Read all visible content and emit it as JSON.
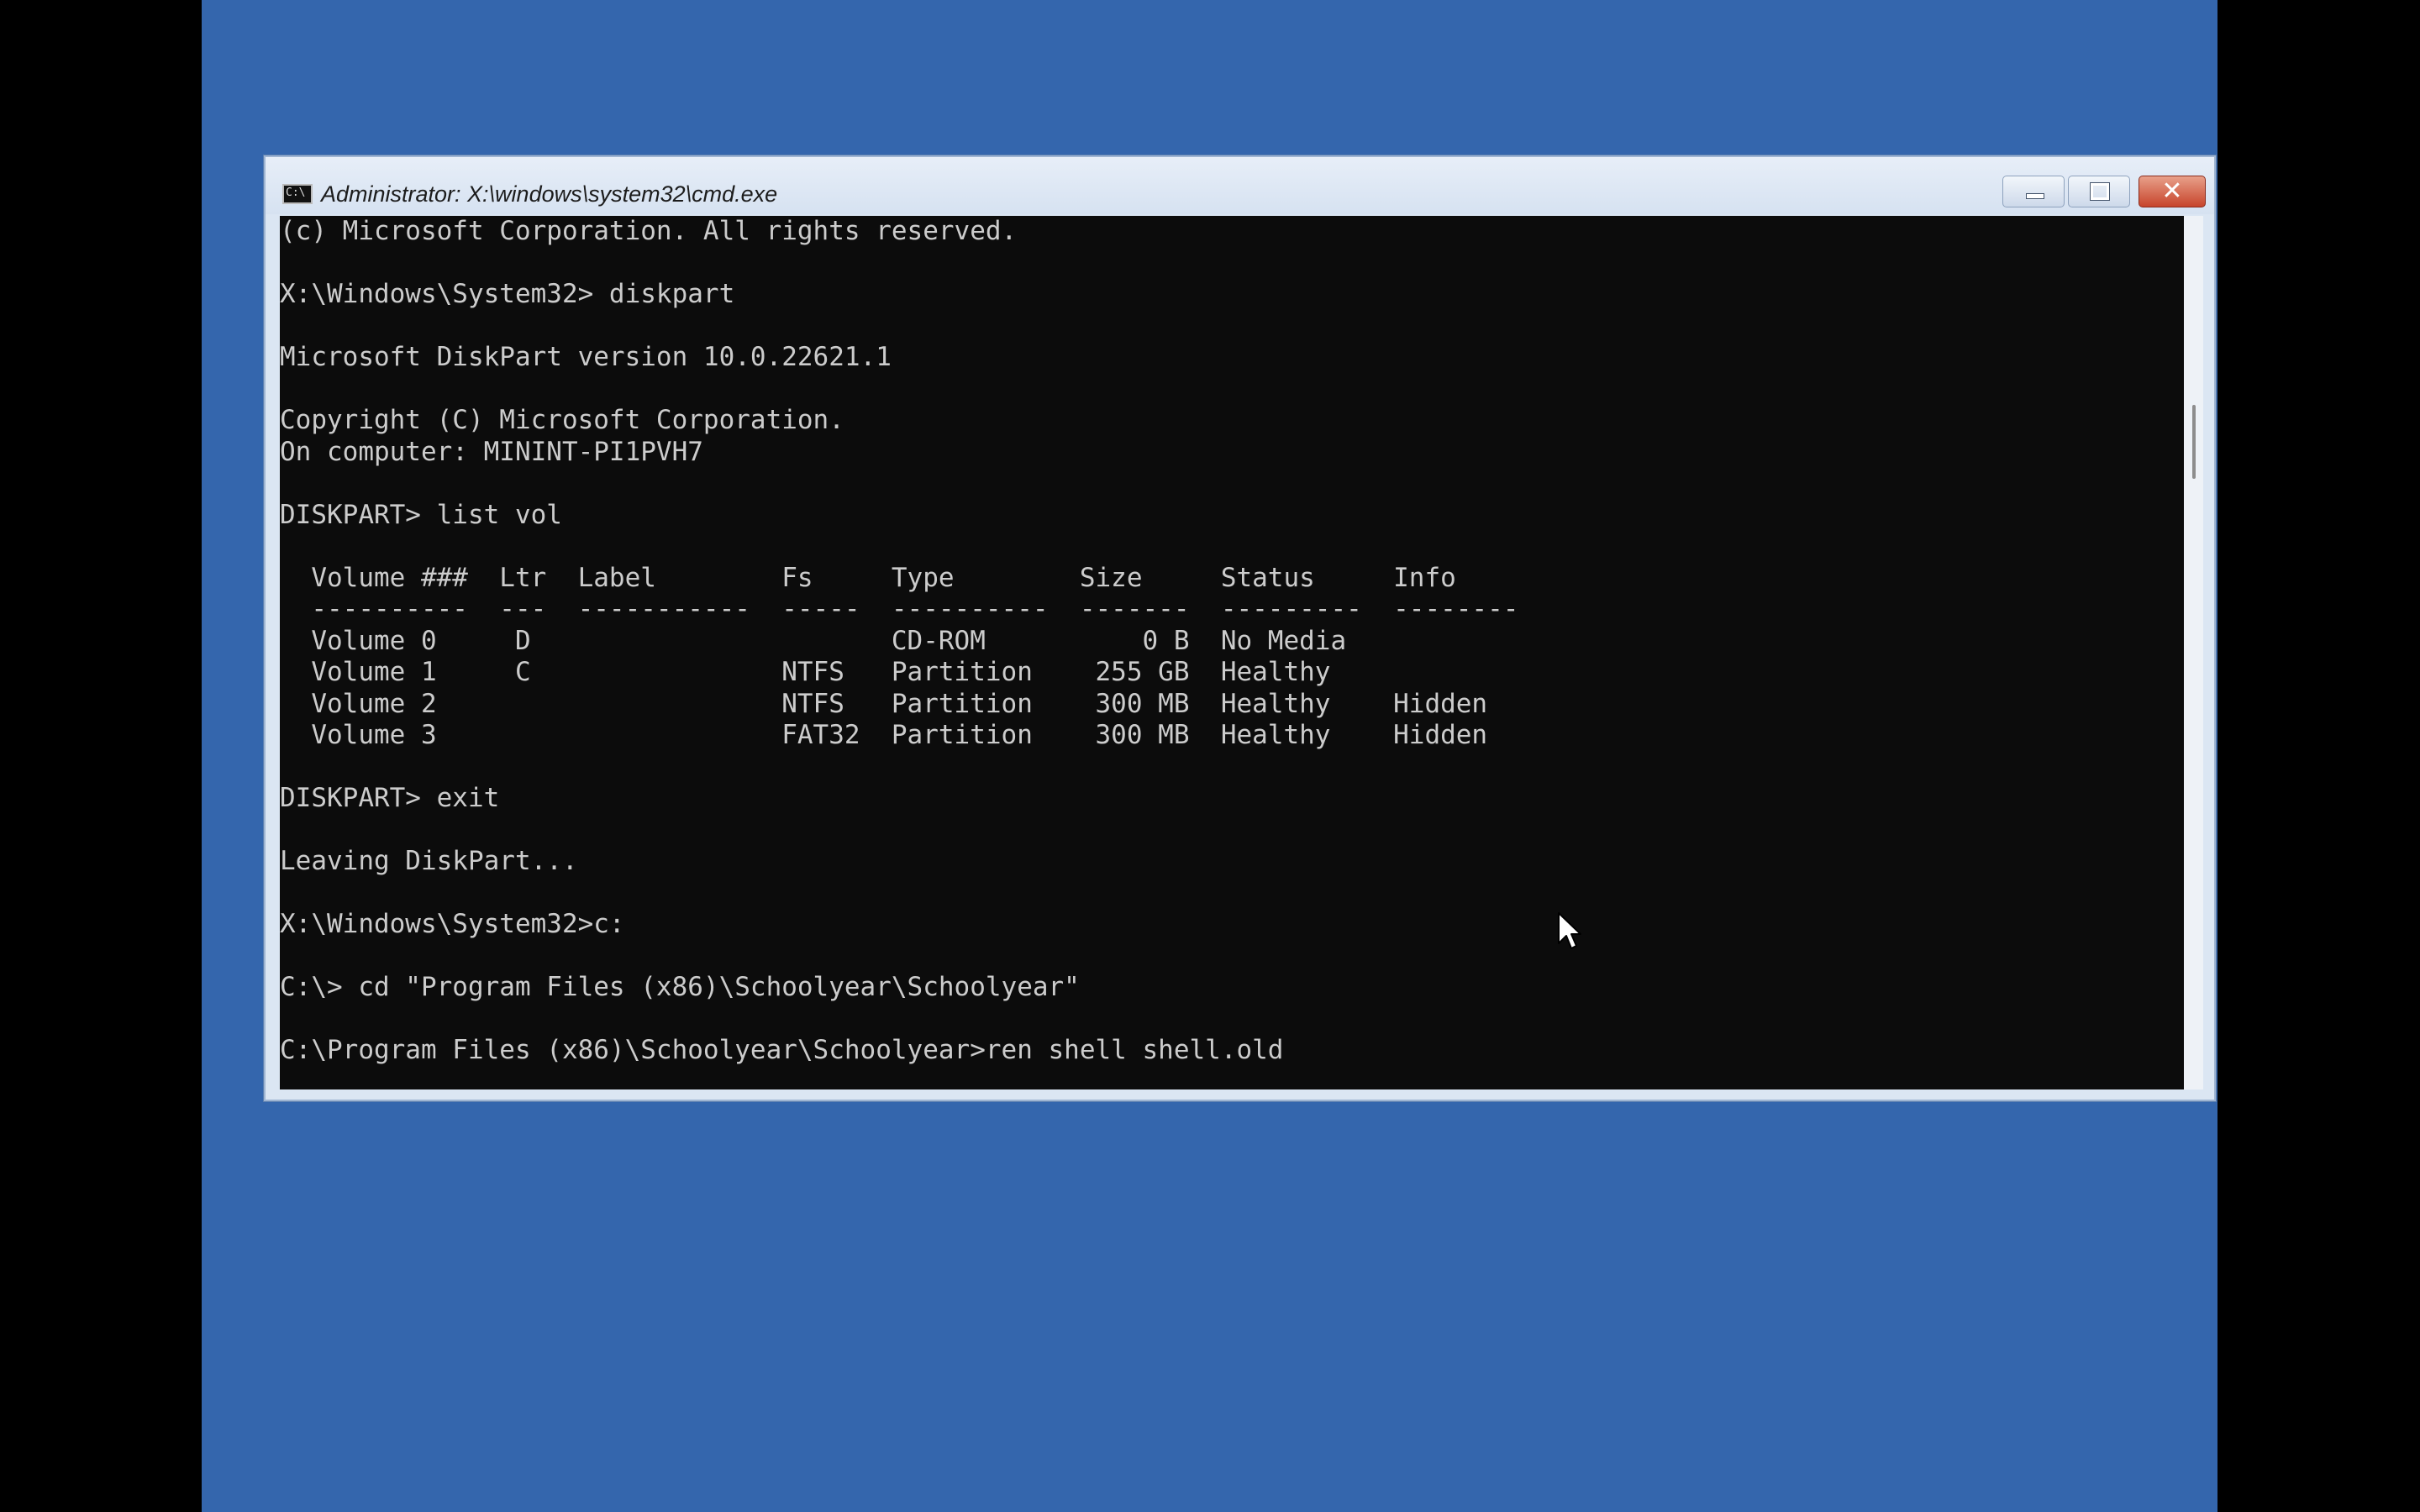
{
  "colors": {
    "desktop_background": "#3466ad",
    "console_background": "#0c0c0c",
    "console_text": "#cccccc",
    "close_button": "#c7442b"
  },
  "window": {
    "title": "Administrator: X:\\windows\\system32\\cmd.exe",
    "icon": "cmd-icon",
    "icon_text": "C:\\"
  },
  "console_lines": [
    "(c) Microsoft Corporation. All rights reserved.",
    "",
    "X:\\Windows\\System32> diskpart",
    "",
    "Microsoft DiskPart version 10.0.22621.1",
    "",
    "Copyright (C) Microsoft Corporation.",
    "On computer: MININT-PI1PVH7",
    "",
    "DISKPART> list vol",
    "",
    "  Volume ###  Ltr  Label        Fs     Type        Size     Status     Info",
    "  ----------  ---  -----------  -----  ----------  -------  ---------  --------",
    "  Volume 0     D                       CD-ROM          0 B  No Media",
    "  Volume 1     C                NTFS   Partition    255 GB  Healthy",
    "  Volume 2                      NTFS   Partition    300 MB  Healthy    Hidden",
    "  Volume 3                      FAT32  Partition    300 MB  Healthy    Hidden",
    "",
    "DISKPART> exit",
    "",
    "Leaving DiskPart...",
    "",
    "X:\\Windows\\System32>c:",
    "",
    "C:\\> cd \"Program Files (x86)\\Schoolyear\\Schoolyear\"",
    "",
    "C:\\Program Files (x86)\\Schoolyear\\Schoolyear>ren shell shell.old"
  ]
}
